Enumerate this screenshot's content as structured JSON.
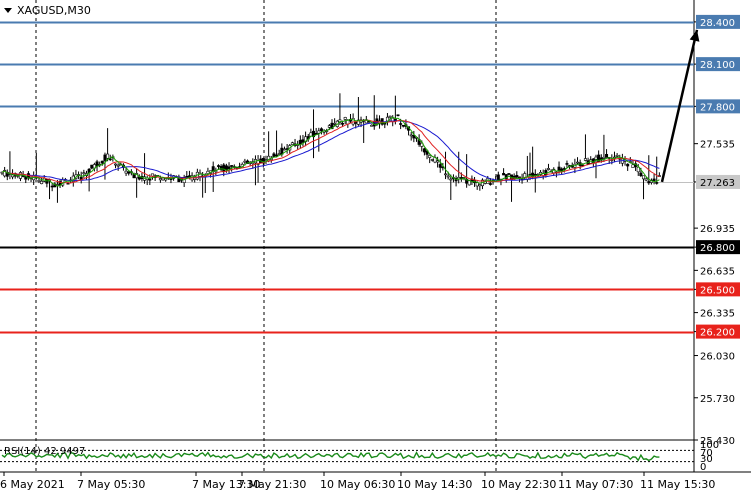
{
  "symbol": "XAGUSD,M30",
  "rsi_label": "RSI(14) 42.9497",
  "colors": {
    "level_blue": "#4a7bb0",
    "level_black": "#000000",
    "level_red": "#e8221b",
    "candle": "#000000",
    "ma_fast": "#1aa000",
    "ma_mid": "#e02020",
    "ma_slow": "#1a1ad0",
    "rsi": "#1a8a1a",
    "grid": "#000000"
  },
  "chart_data": {
    "type": "candlestick",
    "y_ticks": [
      "28.400",
      "28.100",
      "27.800",
      "27.535",
      "27.263",
      "26.935",
      "26.800",
      "26.635",
      "26.500",
      "26.335",
      "26.200",
      "26.030",
      "25.730",
      "25.430"
    ],
    "price_range": [
      25.43,
      28.52
    ],
    "x_labels": [
      "6 May 2021",
      "7 May 05:30",
      "7 May 13:30",
      "7 May 21:30",
      "10 May 06:30",
      "10 May 14:30",
      "10 May 22:30",
      "11 May 07:30",
      "11 May 15:30"
    ],
    "levels": [
      {
        "price": 28.4,
        "label": "28.400",
        "color": "blue"
      },
      {
        "price": 28.1,
        "label": "28.100",
        "color": "blue"
      },
      {
        "price": 27.8,
        "label": "27.800",
        "color": "blue"
      },
      {
        "price": 26.8,
        "label": "26.800",
        "color": "black"
      },
      {
        "price": 26.5,
        "label": "26.500",
        "color": "red"
      },
      {
        "price": 26.2,
        "label": "26.200",
        "color": "red"
      }
    ],
    "current_price": 27.263,
    "close_anchors": [
      [
        0,
        27.33
      ],
      [
        10,
        27.3
      ],
      [
        20,
        27.25
      ],
      [
        30,
        27.3
      ],
      [
        40,
        27.45
      ],
      [
        50,
        27.3
      ],
      [
        60,
        27.3
      ],
      [
        70,
        27.28
      ],
      [
        80,
        27.35
      ],
      [
        90,
        27.38
      ],
      [
        100,
        27.42
      ],
      [
        110,
        27.52
      ],
      [
        120,
        27.62
      ],
      [
        130,
        27.7
      ],
      [
        140,
        27.68
      ],
      [
        150,
        27.72
      ],
      [
        160,
        27.5
      ],
      [
        170,
        27.3
      ],
      [
        180,
        27.25
      ],
      [
        190,
        27.3
      ],
      [
        200,
        27.3
      ],
      [
        210,
        27.35
      ],
      [
        220,
        27.4
      ],
      [
        230,
        27.45
      ],
      [
        240,
        27.38
      ],
      [
        245,
        27.25
      ],
      [
        250,
        27.3
      ]
    ],
    "rsi": {
      "period": 14,
      "value": 42.9497,
      "levels": [
        100,
        70,
        30,
        0
      ],
      "tick_labels": [
        "100",
        "70",
        "30",
        "0"
      ]
    },
    "forecast_arrow": {
      "from_price": 27.263,
      "to_price": 28.4
    }
  }
}
